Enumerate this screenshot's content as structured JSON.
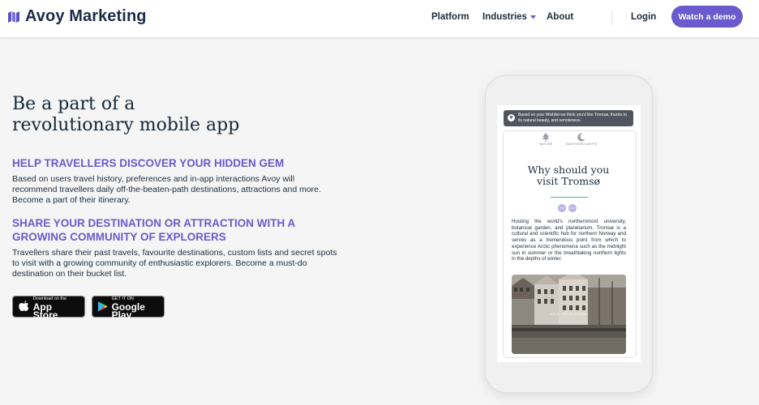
{
  "brand": {
    "name": "Avoy Marketing",
    "icon": "map-icon"
  },
  "nav": {
    "platform": "Platform",
    "industries": "Industries",
    "about": "About",
    "login": "Login",
    "demo": "Watch a demo"
  },
  "hero": {
    "title_line1": "Be a part of a",
    "title_line2": "revolutionary mobile app"
  },
  "sections": [
    {
      "heading": "HELP TRAVELLERS DISCOVER YOUR HIDDEN GEM",
      "body": "Based on users travel history, preferences and in-app interactions Avoy will recommend travellers daily off-the-beaten-path destinations, attractions and more. Become a part of their itinerary."
    },
    {
      "heading": "SHARE YOUR DESTINATION OR ATTRACTION WITH A GROWING COMMUNITY OF EXPLORERS",
      "body": "Travellers share their past travels, favourite destinations, custom lists and secret spots to visit with a growing community of enthusiastic explorers. Become a must-do destination on their bucket list."
    }
  ],
  "stores": {
    "apple_small": "Download on the",
    "apple_big": "App Store",
    "google_small": "GET IT ON",
    "google_big": "Google Play"
  },
  "phone": {
    "notice": "Based on your Wishlist we think you'd like Tromsø, thanks to its natural beauty, and remoteness.",
    "tags": [
      "NATURE",
      "NORTHERN LIGHTS"
    ],
    "title_line1": "Why should you",
    "title_line2": "visit Tromsø",
    "chips": [
      "EN",
      "DU"
    ],
    "description": "Hosting the world's northernmost university, botanical garden, and planetarium, Tromsø is a cultural and scientific hub for northern Norway and serves as a tremendous point from which to experience Arctic phenomena such as the midnight sun in summer or the breathtaking northern lights in the depths of winter.",
    "photo_caption": "Tap to view photo/video"
  },
  "colors": {
    "accent": "#6a5acd",
    "navy": "#1d2b4a",
    "green": "#3fb98a"
  }
}
